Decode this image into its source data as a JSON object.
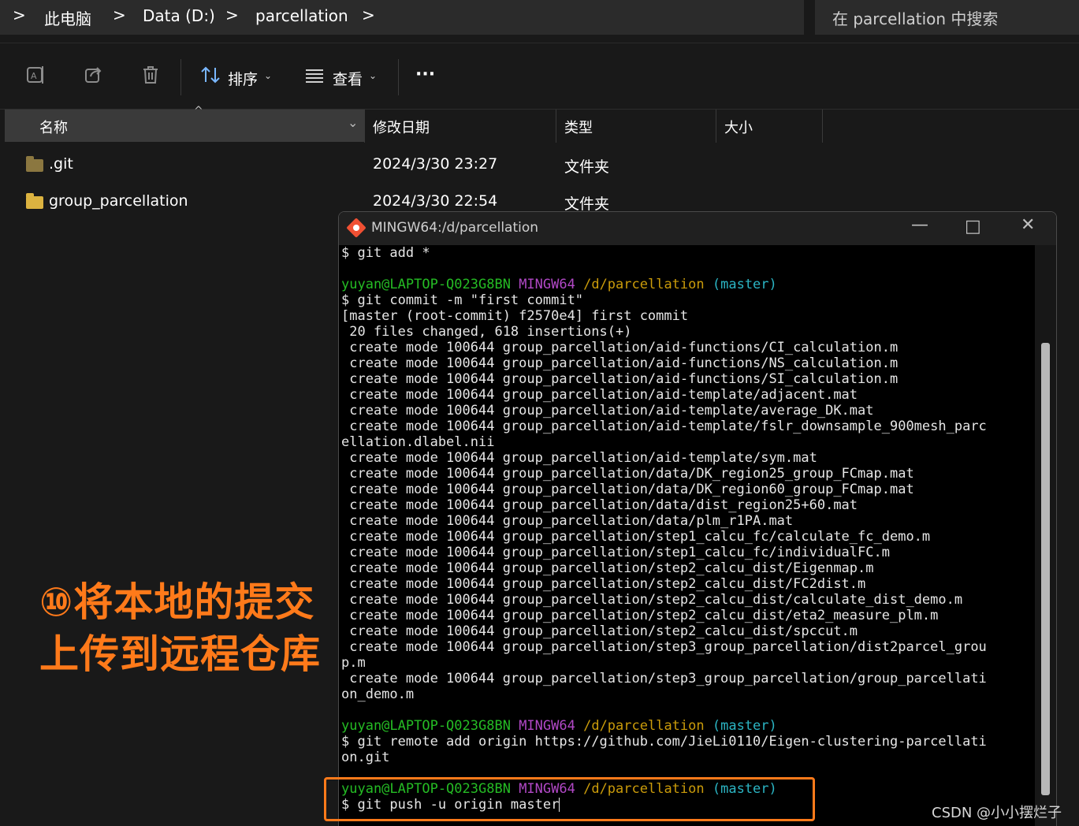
{
  "address_bar": {
    "crumbs": [
      "此电脑",
      "Data (D:)",
      "parcellation"
    ],
    "chevron": ">"
  },
  "search": {
    "placeholder": "在 parcellation 中搜索"
  },
  "toolbar": {
    "sort_label": "排序",
    "view_label": "查看",
    "more_label": "···",
    "caret": "⌄"
  },
  "columns": {
    "name": "名称",
    "modified": "修改日期",
    "type": "类型",
    "size": "大小"
  },
  "files": [
    {
      "name": ".git",
      "modified": "2024/3/30 23:27",
      "type": "文件夹"
    },
    {
      "name": "group_parcellation",
      "modified": "2024/3/30 22:54",
      "type": "文件夹"
    }
  ],
  "overlay": {
    "line1": "⑩将本地的提交",
    "line2": "上传到远程仓库",
    "color": "#ff7a1a"
  },
  "terminal": {
    "title": "MINGW64:/d/parcellation",
    "prompt": {
      "user": "yuyan@LAPTOP-Q023G8BN",
      "env": "MINGW64",
      "path": "/d/parcellation",
      "branch": "(master)"
    },
    "lines": [
      "$ git add *",
      "",
      "$ git commit -m \"first commit\"",
      "[master (root-commit) f2570e4] first commit",
      " 20 files changed, 618 insertions(+)",
      " create mode 100644 group_parcellation/aid-functions/CI_calculation.m",
      " create mode 100644 group_parcellation/aid-functions/NS_calculation.m",
      " create mode 100644 group_parcellation/aid-functions/SI_calculation.m",
      " create mode 100644 group_parcellation/aid-template/adjacent.mat",
      " create mode 100644 group_parcellation/aid-template/average_DK.mat",
      " create mode 100644 group_parcellation/aid-template/fslr_downsample_900mesh_parc",
      "ellation.dlabel.nii",
      " create mode 100644 group_parcellation/aid-template/sym.mat",
      " create mode 100644 group_parcellation/data/DK_region25_group_FCmap.mat",
      " create mode 100644 group_parcellation/data/DK_region60_group_FCmap.mat",
      " create mode 100644 group_parcellation/data/dist_region25+60.mat",
      " create mode 100644 group_parcellation/data/plm_r1PA.mat",
      " create mode 100644 group_parcellation/step1_calcu_fc/calculate_fc_demo.m",
      " create mode 100644 group_parcellation/step1_calcu_fc/individualFC.m",
      " create mode 100644 group_parcellation/step2_calcu_dist/Eigenmap.m",
      " create mode 100644 group_parcellation/step2_calcu_dist/FC2dist.m",
      " create mode 100644 group_parcellation/step2_calcu_dist/calculate_dist_demo.m",
      " create mode 100644 group_parcellation/step2_calcu_dist/eta2_measure_plm.m",
      " create mode 100644 group_parcellation/step2_calcu_dist/spccut.m",
      " create mode 100644 group_parcellation/step3_group_parcellation/dist2parcel_grou",
      "p.m",
      " create mode 100644 group_parcellation/step3_group_parcellation/group_parcellati",
      "on_demo.m",
      "",
      "$ git remote add origin https://github.com/JieLi0110/Eigen-clustering-parcellati",
      "on.git",
      "",
      "$ git push -u origin master"
    ],
    "colors": {
      "user": "#25bc24",
      "env": "#b148c6",
      "path": "#ca9b0a",
      "branch": "#2bb5c4"
    }
  },
  "watermark": "CSDN @小小摆烂子"
}
